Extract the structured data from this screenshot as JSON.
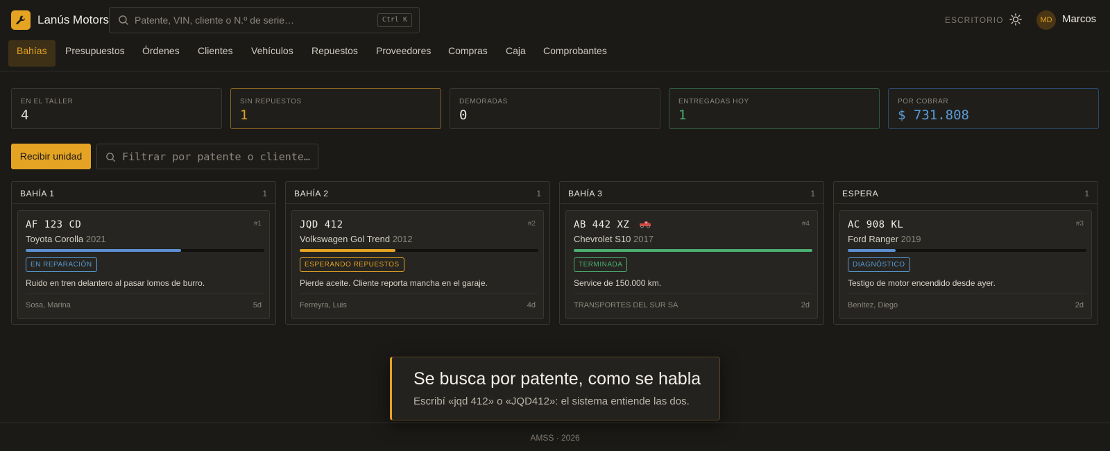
{
  "app": {
    "brand": "Lanús Motors",
    "logo_icon": "wrench-icon"
  },
  "search": {
    "placeholder": "Patente, VIN, cliente o N.º de serie…",
    "shortcut": "Ctrl K"
  },
  "header": {
    "desk_label": "ESCRITORIO",
    "user_initials": "MD",
    "user_name": "Marcos"
  },
  "nav": {
    "tabs": [
      "Bahías",
      "Presupuestos",
      "Órdenes",
      "Clientes",
      "Vehículos",
      "Repuestos",
      "Proveedores",
      "Compras",
      "Caja",
      "Comprobantes"
    ],
    "active": "Bahías"
  },
  "kpis": [
    {
      "label": "EN EL TALLER",
      "value": "4",
      "color": "#e8e4dc",
      "border": "#3a3732"
    },
    {
      "label": "SIN REPUESTOS",
      "value": "1",
      "color": "#e5a324",
      "border": "#8a6420"
    },
    {
      "label": "DEMORADAS",
      "value": "0",
      "color": "#e8e4dc",
      "border": "#3a3732"
    },
    {
      "label": "ENTREGADAS HOY",
      "value": "1",
      "color": "#4caf72",
      "border": "#2e5a40"
    },
    {
      "label": "POR COBRAR",
      "value": "$ 731.808",
      "color": "#5b9bd5",
      "border": "#2b4a6b"
    }
  ],
  "actions": {
    "receive_label": "Recibir unidad",
    "filter_placeholder": "Filtrar por patente o cliente…"
  },
  "bays": [
    {
      "name": "BAHÍA 1",
      "count": "1",
      "card": {
        "plate": "AF 123 CD",
        "num": "#1",
        "model": "Toyota Corolla",
        "year": "2021",
        "progress": 0.65,
        "bar_color": "#5b8fd0",
        "status": "EN REPARACIÓN",
        "status_color": "#5b9bd5",
        "desc": "Ruido en tren delantero al pasar lomos de burro.",
        "owner": "Sosa, Marina",
        "age": "5d"
      }
    },
    {
      "name": "BAHÍA 2",
      "count": "1",
      "card": {
        "plate": "JQD 412",
        "num": "#2",
        "model": "Volkswagen Gol Trend",
        "year": "2012",
        "progress": 0.4,
        "bar_color": "#e5a324",
        "status": "ESPERANDO REPUESTOS",
        "status_color": "#e5a324",
        "desc": "Pierde aceite. Cliente reporta mancha en el garaje.",
        "owner": "Ferreyra, Luis",
        "age": "4d"
      }
    },
    {
      "name": "BAHÍA 3",
      "count": "1",
      "card": {
        "plate": "AB 442 XZ",
        "num": "#4",
        "model": "Chevrolet S10",
        "year": "2017",
        "progress": 1.0,
        "bar_color": "#4caf72",
        "status": "TERMINADA",
        "status_color": "#4caf72",
        "desc": "Service de 150.000 km.",
        "owner": "TRANSPORTES DEL SUR SA",
        "age": "2d",
        "fleet_icon": "red-pickup-truck-icon"
      }
    },
    {
      "name": "ESPERA",
      "count": "1",
      "card": {
        "plate": "AC 908 KL",
        "num": "#3",
        "model": "Ford Ranger",
        "year": "2019",
        "progress": 0.2,
        "bar_color": "#5b8fd0",
        "status": "DIAGNÓSTICO",
        "status_color": "#5b9bd5",
        "desc": "Testigo de motor encendido desde ayer.",
        "owner": "Benítez, Diego",
        "age": "2d"
      }
    }
  ],
  "tip": {
    "title": "Se busca por patente, como se habla",
    "body": "Escribí «jqd 412» o «JQD412»: el sistema entiende las dos."
  },
  "footer": {
    "text": "AMSS · 2026"
  }
}
